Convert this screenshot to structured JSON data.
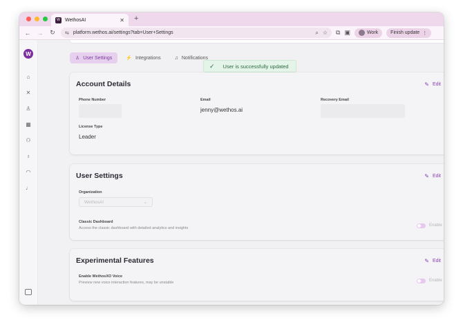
{
  "browser": {
    "tab_title": "WethosAI",
    "tab_favicon_letter": "W",
    "url": "platform.wethos.ai/settings?tab=User+Settings",
    "profile_label": "Work",
    "finish_update_label": "Finish update",
    "colors": {
      "close": "#fe5f57",
      "minimize": "#febc2e",
      "maximize": "#28c840"
    }
  },
  "settings_tabs": [
    {
      "label": "User Settings",
      "icon": "user-icon"
    },
    {
      "label": "Integrations",
      "icon": "plug-icon"
    },
    {
      "label": "Notifications",
      "icon": "bell-icon"
    }
  ],
  "toast": {
    "message": "User is successfully updated"
  },
  "account_details": {
    "title": "Account Details",
    "edit_label": "Edit",
    "phone_label": "Phone Number",
    "phone_value": "",
    "email_label": "Email",
    "email_value": "jenny@wethos.ai",
    "recovery_label": "Recovery Email",
    "recovery_value": "",
    "license_label": "License Type",
    "license_value": "Leader"
  },
  "user_settings": {
    "title": "User Settings",
    "edit_label": "Edit",
    "org_label": "Organization",
    "org_value": "WethosAI",
    "classic_title": "Classic Dashboard",
    "classic_desc": "Access the classic dashboard with detailed analytics and insights",
    "classic_toggle_label": "Enable"
  },
  "experimental": {
    "title": "Experimental Features",
    "edit_label": "Edit",
    "voice_title": "Enable WethosXO Voice",
    "voice_desc": "Preview new voice interaction features, may be unstable",
    "voice_toggle_label": "Enable"
  },
  "sidebar_icons": [
    "home-icon",
    "tools-icon",
    "person-icon",
    "calendar-icon",
    "team-icon",
    "lightbulb-icon",
    "gauge-icon",
    "microphone-icon"
  ]
}
